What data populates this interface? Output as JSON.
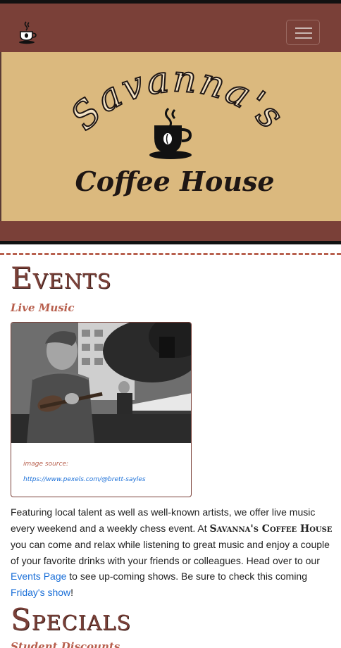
{
  "navbar": {
    "logo_icon": "coffee-cup-icon",
    "toggler_icon": "hamburger-menu-icon",
    "colors": {
      "bar": "#7a4038",
      "accent": "#dbb97e"
    }
  },
  "hero": {
    "arc_title": "Savanna's",
    "subtitle": "Coffee House",
    "icon": "coffee-cup-icon"
  },
  "events": {
    "heading": "Events",
    "subheading": "Live Music",
    "card": {
      "image_alt": "street musician playing ukulele",
      "source_label": "image source:",
      "source_link": "https://www.pexels.com/@brett-sayles"
    },
    "paragraph": {
      "part1": "Featuring local talent as well as well-known artists, we offer live music every weekend and a weekly chess event. At ",
      "brand": "Savanna's Coffee House",
      "part2": " you can come and relax while listening to great music and enjoy a couple of your favorite drinks with your friends or colleagues. Head over to our ",
      "link1": "Events Page",
      "part3": " to see up-coming shows. Be sure to check this coming ",
      "link2": "Friday's show",
      "part4": "!"
    }
  },
  "specials": {
    "heading": "Specials",
    "subheading": "Student Discounts"
  }
}
